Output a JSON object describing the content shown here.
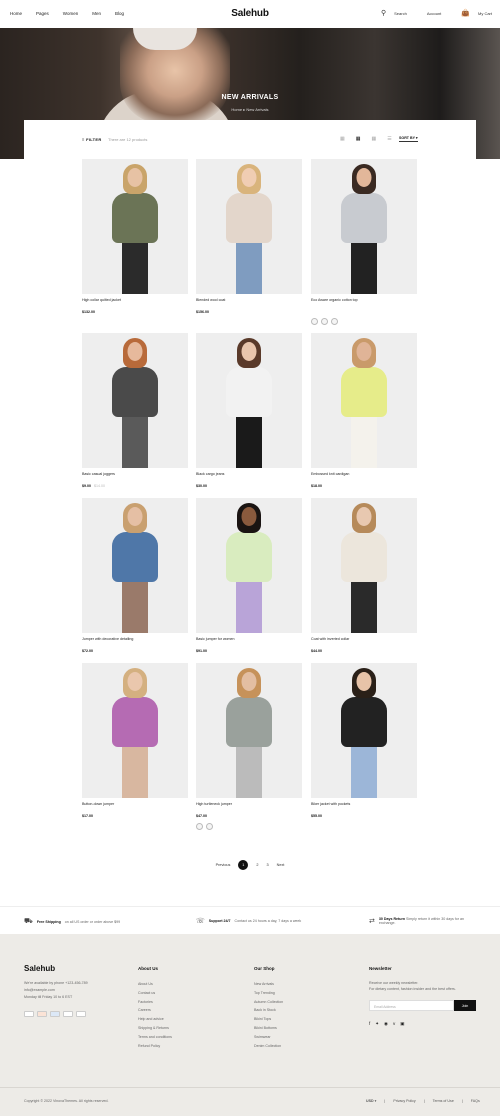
{
  "header": {
    "nav": [
      "Home",
      "Pages",
      "Women",
      "Men",
      "Blog"
    ],
    "logo": "Salehub",
    "search": "Search",
    "account": "Account",
    "cart": "My Cart"
  },
  "hero": {
    "title": "NEW ARRIVALS",
    "breadcrumb": "Home  ▸  New Arrivals"
  },
  "toolbar": {
    "filter": "FILTER",
    "showing": "There are 12 products",
    "sort": "SORT BY"
  },
  "products": [
    {
      "name": "High collar quilted jacket",
      "price": "$132.00",
      "old": ""
    },
    {
      "name": "Blended wool coat",
      "price": "$156.00",
      "old": ""
    },
    {
      "name": "Eco Aware organic cotton top",
      "price": "",
      "old": ""
    },
    {
      "name": "Basic casual joggers",
      "price": "$9.00",
      "old": "$14.00"
    },
    {
      "name": "Black cargo jeans",
      "price": "$30.00",
      "old": ""
    },
    {
      "name": "Embossed knit cardigan",
      "price": "$18.00",
      "old": ""
    },
    {
      "name": "Jumper with decorative detailing",
      "price": "$72.00",
      "old": ""
    },
    {
      "name": "Basic jumper for women",
      "price": "$91.00",
      "old": ""
    },
    {
      "name": "Coat with inverted collar",
      "price": "$44.00",
      "old": ""
    },
    {
      "name": "Button-down jumper",
      "price": "$17.00",
      "old": ""
    },
    {
      "name": "High turtleneck jumper",
      "price": "$47.00",
      "old": ""
    },
    {
      "name": "Biker jacket with pockets",
      "price": "$55.00",
      "old": ""
    }
  ],
  "pagination": {
    "prev": "Previous",
    "pages": [
      "1",
      "2",
      "3"
    ],
    "next": "Next"
  },
  "perks": [
    {
      "bold": "Free Shipping",
      "text": "on all US order or order above $99"
    },
    {
      "bold": "Support 24/7",
      "text": "Contact us 24 hours a day, 7 days a week"
    },
    {
      "bold": "30 Days Return",
      "text": "Simply return it within 30 days for an exchange."
    }
  ],
  "footer": {
    "logo": "Salehub",
    "contact": [
      "We're available by phone +123-456-789",
      "info@example.com",
      "Monday till Friday 10 to 6 EST"
    ],
    "about_title": "About Us",
    "about": [
      "About Us",
      "Contact us",
      "Factories",
      "Careers",
      "Help and advice",
      "Shipping & Returns",
      "Terms and conditions",
      "Refund Policy"
    ],
    "shop_title": "Our Shop",
    "shop": [
      "New Arrivals",
      "Top Trending",
      "Autumn Collection",
      "Back in Stock",
      "Bikini Tops",
      "Bikini Bottoms",
      "Swimwear",
      "Denim Collection"
    ],
    "news_title": "Newsletter",
    "news_text": [
      "Receive our weekly newsletter.",
      "For dietary content, fashion insider and the best offers."
    ],
    "email_placeholder": "Email Address",
    "join": "Join",
    "copyright": "Copyright © 2022 VinovaThemes. All rights reserved.",
    "currency": "USD",
    "links": [
      "Privacy Policy",
      "Terms of Use",
      "FAQs"
    ]
  }
}
